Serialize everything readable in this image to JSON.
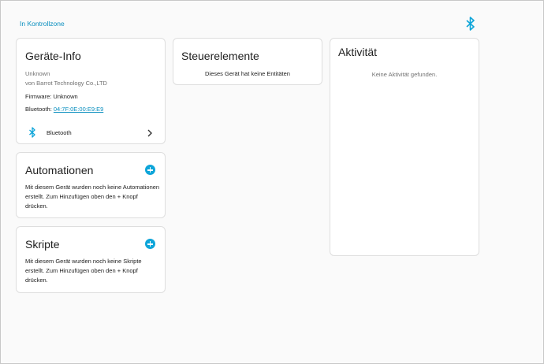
{
  "topbar": {
    "back_link": "In Kontrollzone",
    "icon": "bluetooth-icon"
  },
  "device_info": {
    "title": "Geräte-Info",
    "model": "Unknown",
    "manufacturer": "von Barrot Technology Co.,LTD",
    "firmware": "Firmware: Unknown",
    "bluetooth_label": "Bluetooth:",
    "bluetooth_mac": "04:7F:0E:00:E9:E9",
    "integration_label": "Bluetooth",
    "integration_icon": "bluetooth-icon"
  },
  "automations": {
    "title": "Automationen",
    "text": "Mit diesem Gerät wurden noch keine Automationen erstellt. Zum Hinzufügen oben den + Knopf drücken."
  },
  "scripts": {
    "title": "Skripte",
    "text": "Mit diesem Gerät wurden noch keine Skripte erstellt. Zum Hinzufügen oben den + Knopf drücken."
  },
  "controls": {
    "title": "Steuerelemente",
    "text": "Dieses Gerät hat keine Entitäten"
  },
  "activity": {
    "title": "Aktivität",
    "text": "Keine Aktivität gefunden."
  },
  "colors": {
    "accent": "#0a8fbf",
    "bluetooth": "#0ea5d9"
  }
}
